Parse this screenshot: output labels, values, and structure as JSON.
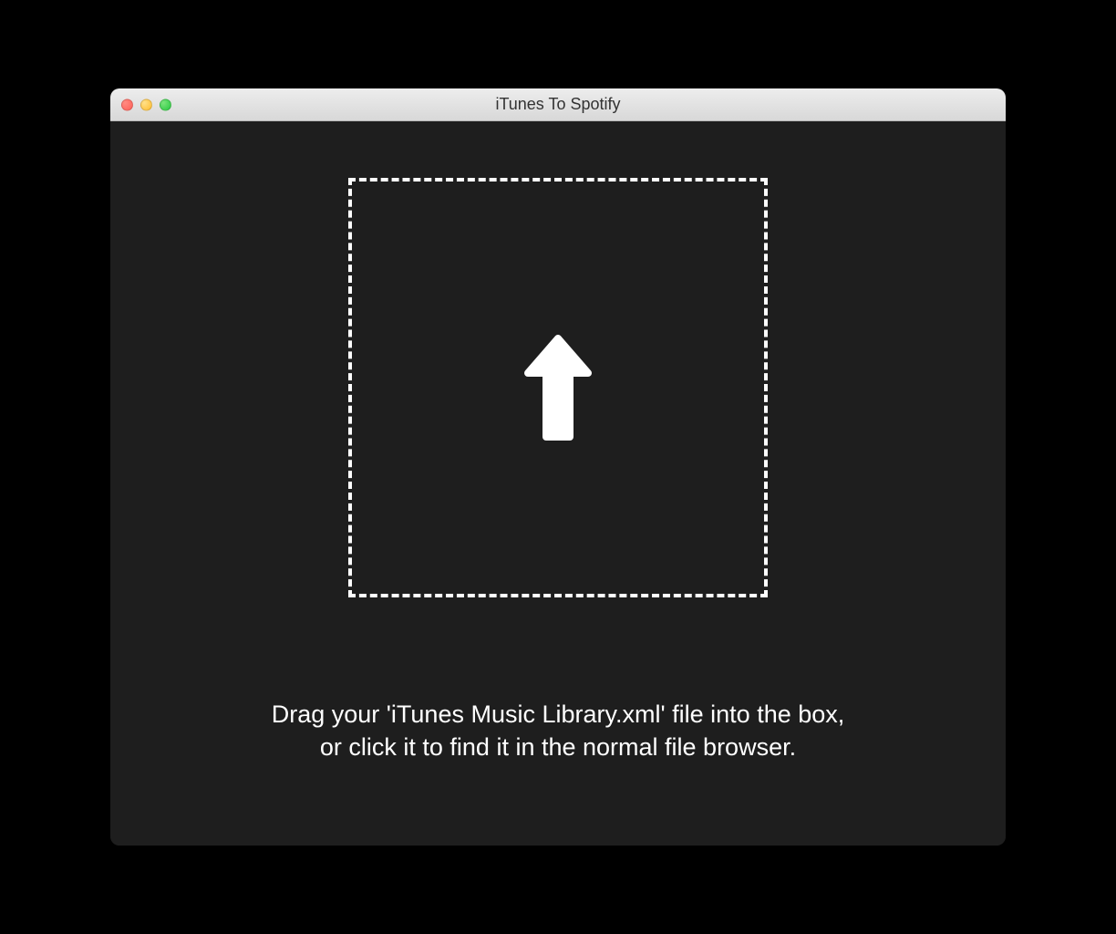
{
  "window": {
    "title": "iTunes To Spotify"
  },
  "main": {
    "instruction_line1": "Drag your 'iTunes Music Library.xml' file into the box,",
    "instruction_line2": "or click it to find it in the normal file browser."
  }
}
